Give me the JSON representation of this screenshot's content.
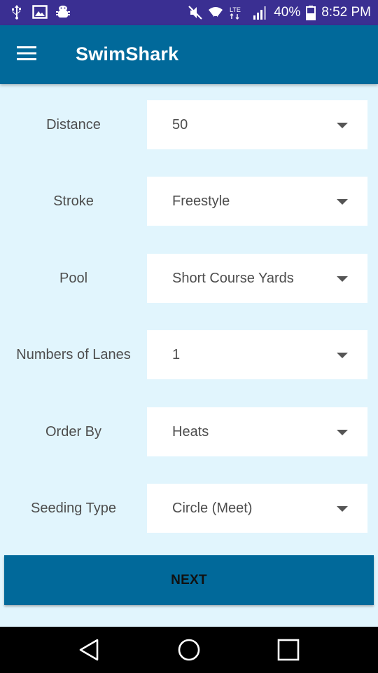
{
  "status_bar": {
    "battery": "40%",
    "time": "8:52 PM",
    "icons": [
      "usb-icon",
      "image-icon",
      "android-debug-icon",
      "mute-icon",
      "wifi-icon",
      "lte-icon",
      "signal-icon",
      "battery-icon"
    ]
  },
  "app_bar": {
    "title": "SwimShark",
    "menu_icon": "hamburger-menu-icon",
    "color": "#01699a"
  },
  "form": {
    "rows": [
      {
        "label": "Distance",
        "value": "50"
      },
      {
        "label": "Stroke",
        "value": "Freestyle"
      },
      {
        "label": "Pool",
        "value": "Short Course Yards"
      },
      {
        "label": "Numbers of Lanes",
        "value": "1"
      },
      {
        "label": "Order By",
        "value": "Heats"
      },
      {
        "label": "Seeding Type",
        "value": "Circle (Meet)"
      }
    ]
  },
  "next_button": {
    "label": "NEXT"
  },
  "nav_bar": {
    "icons": [
      "back-icon",
      "home-icon",
      "recents-icon"
    ]
  },
  "colors": {
    "background": "#e1f5fd",
    "primary": "#01699a",
    "status_bar": "#3a2f92"
  }
}
